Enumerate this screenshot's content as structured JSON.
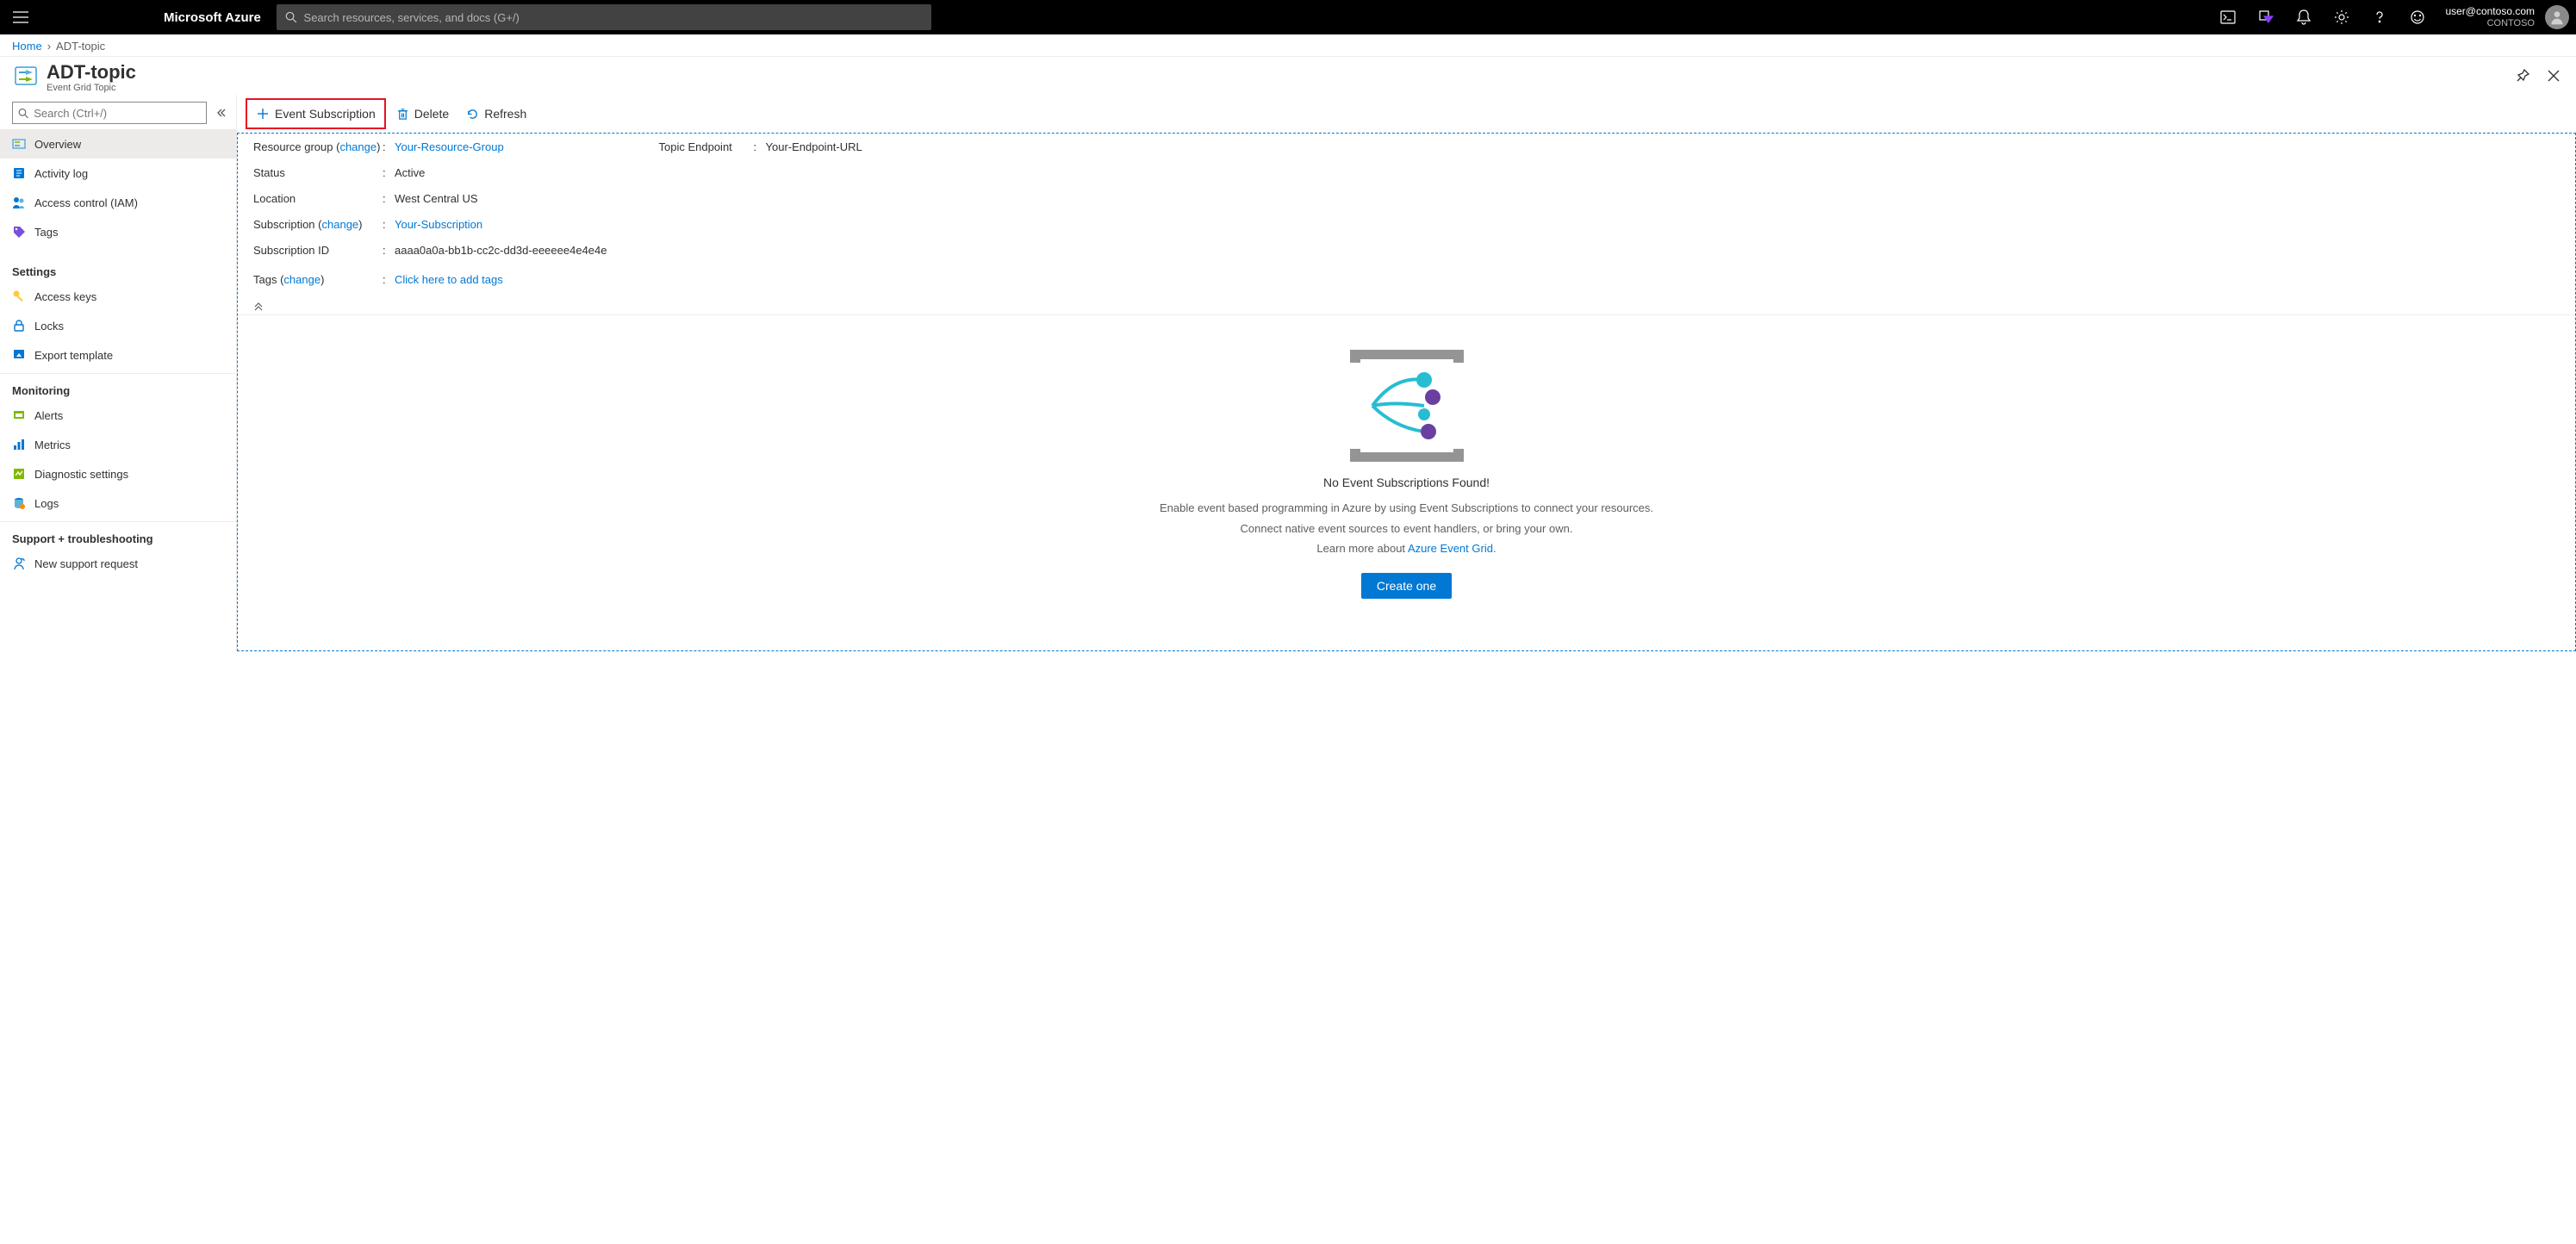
{
  "topbar": {
    "brand": "Microsoft Azure",
    "search_placeholder": "Search resources, services, and docs (G+/)",
    "user_email": "user@contoso.com",
    "tenant": "CONTOSO"
  },
  "breadcrumb": {
    "home": "Home",
    "current": "ADT-topic"
  },
  "header": {
    "title": "ADT-topic",
    "subtitle": "Event Grid Topic"
  },
  "sidebar": {
    "search_placeholder": "Search (Ctrl+/)",
    "items": {
      "overview": "Overview",
      "activity": "Activity log",
      "iam": "Access control (IAM)",
      "tags": "Tags"
    },
    "sections": {
      "settings": "Settings",
      "monitoring": "Monitoring",
      "support": "Support + troubleshooting"
    },
    "settings_items": {
      "keys": "Access keys",
      "locks": "Locks",
      "export": "Export template"
    },
    "monitoring_items": {
      "alerts": "Alerts",
      "metrics": "Metrics",
      "diag": "Diagnostic settings",
      "logs": "Logs"
    },
    "support_items": {
      "newreq": "New support request"
    }
  },
  "cmdbar": {
    "event_sub": "Event Subscription",
    "delete": "Delete",
    "refresh": "Refresh"
  },
  "essentials": {
    "rg_label": "Resource group",
    "rg_change": "change",
    "rg_value": "Your-Resource-Group",
    "status_label": "Status",
    "status_value": "Active",
    "location_label": "Location",
    "location_value": "West Central US",
    "sub_label": "Subscription",
    "sub_change": "change",
    "sub_value": "Your-Subscription",
    "subid_label": "Subscription ID",
    "subid_value": "aaaa0a0a-bb1b-cc2c-dd3d-eeeeee4e4e4e",
    "tags_label": "Tags",
    "tags_change": "change",
    "tags_value": "Click here to add tags",
    "endpoint_label": "Topic Endpoint",
    "endpoint_value": "Your-Endpoint-URL"
  },
  "empty": {
    "title": "No Event Subscriptions Found!",
    "line1": "Enable event based programming in Azure by using Event Subscriptions to connect your resources.",
    "line2": "Connect native event sources to event handlers, or bring your own.",
    "line3_prefix": "Learn more about ",
    "line3_link": "Azure Event Grid",
    "button": "Create one"
  }
}
